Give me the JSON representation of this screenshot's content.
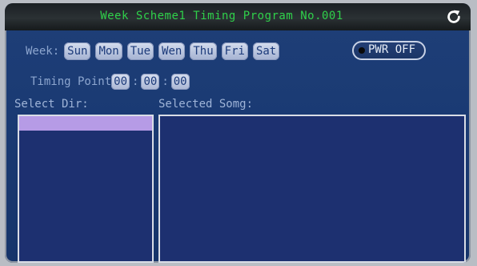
{
  "header": {
    "title": "Week Scheme1 Timing Program No.001",
    "back_icon": "return-arrow-icon"
  },
  "week": {
    "label": "Week:",
    "days": [
      "Sun",
      "Mon",
      "Tue",
      "Wen",
      "Thu",
      "Fri",
      "Sat"
    ]
  },
  "power": {
    "label": "PWR OFF"
  },
  "timing": {
    "label": "Timing Point",
    "hour": "00",
    "minute": "00",
    "second": "00",
    "separator": ":"
  },
  "select_dir": {
    "label": "Select Dir:"
  },
  "selected_song": {
    "label": "Selected Somg:"
  },
  "colors": {
    "title_text": "#2fd04a",
    "selected_row": "#b69be6",
    "panel_bg": "#1d3070"
  }
}
